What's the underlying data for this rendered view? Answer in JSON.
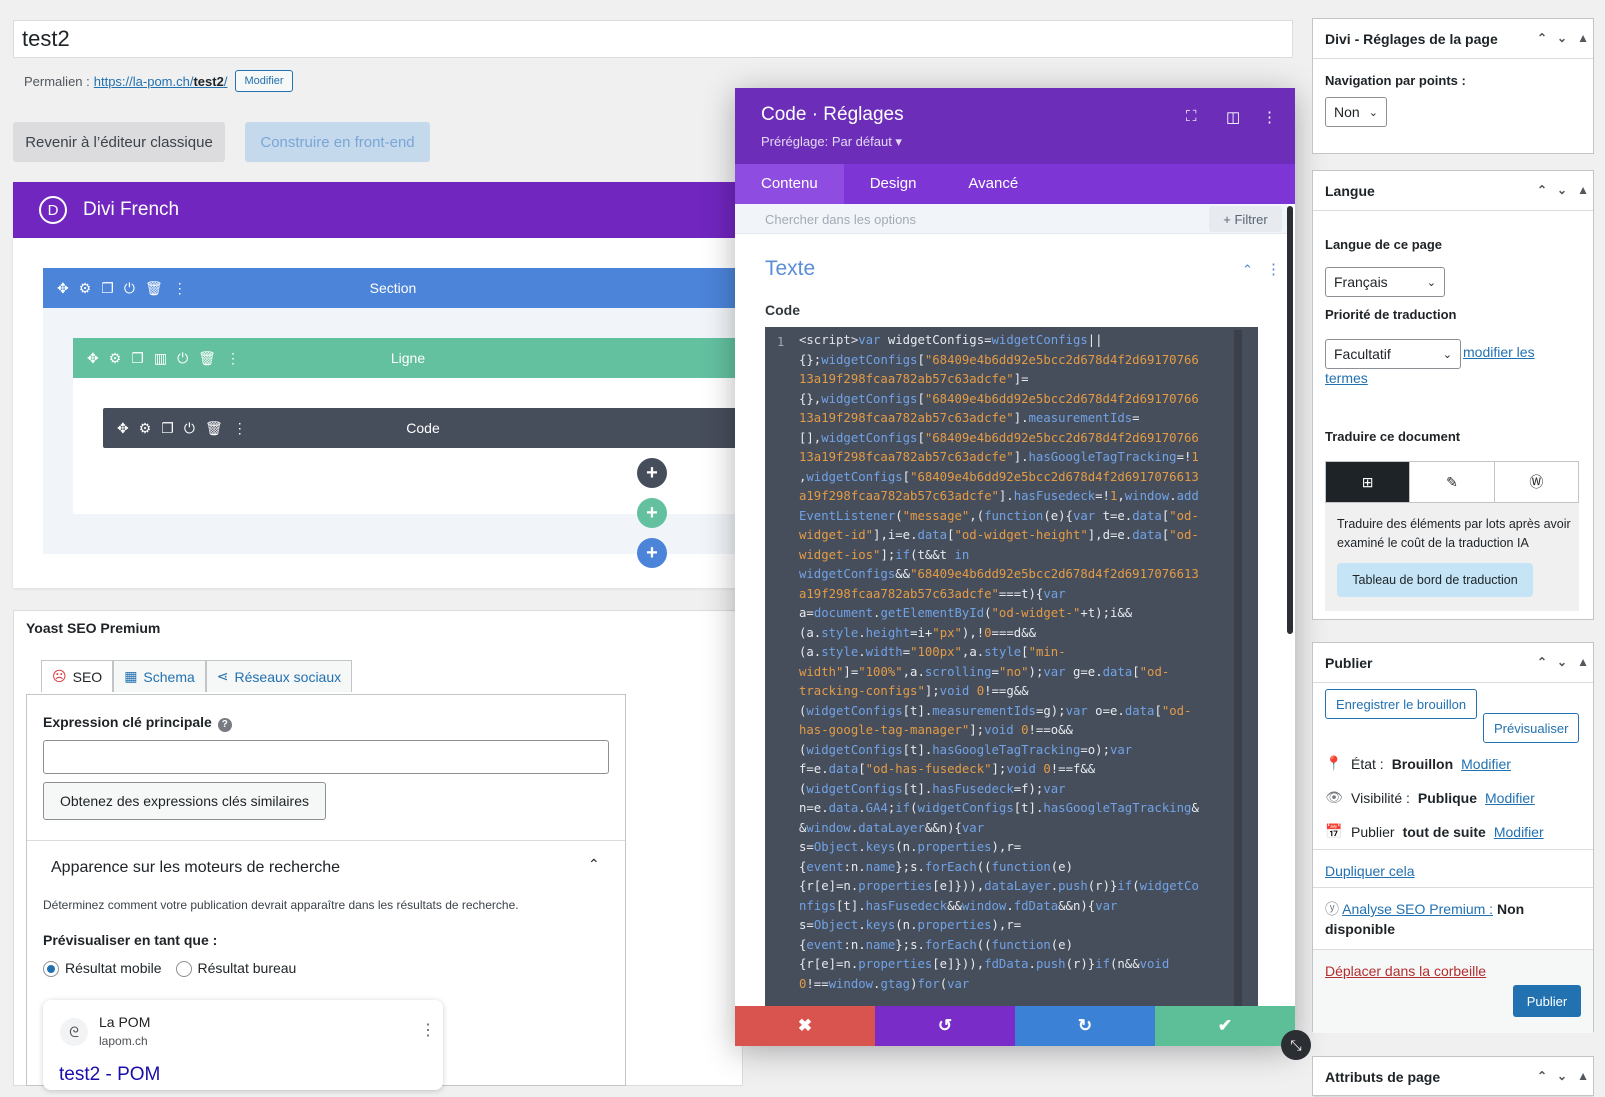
{
  "post": {
    "title": "test2",
    "permalink_label": "Permalien :",
    "permalink_url": "https://la-pom.ch/test2/",
    "permalink_base": "https://la-pom.ch/",
    "permalink_slug": "test2",
    "permalink_edit": "Modifier"
  },
  "editor_buttons": {
    "classic": "Revenir à l’éditeur classique",
    "frontend": "Construire en front-end"
  },
  "divi": {
    "logo_letter": "D",
    "title": "Divi French",
    "section_label": "Section",
    "row_label": "Ligne",
    "module_label": "Code",
    "colors": {
      "header": "#7026bf",
      "section": "#4c84d9",
      "row": "#63c1a0",
      "module": "#474e5b"
    }
  },
  "yoast": {
    "title": "Yoast SEO Premium",
    "tabs": [
      "SEO",
      "Schema",
      "Réseaux sociaux"
    ],
    "keyphrase_label": "Expression clé principale",
    "keyphrase_help": "?",
    "keyphrase_value": "",
    "related_button": "Obtenez des expressions clés similaires",
    "appearance_title": "Apparence sur les moteurs de recherche",
    "appearance_desc": "Déterminez comment votre publication devrait apparaître dans les résultats de recherche.",
    "preview_as": "Prévisualiser en tant que :",
    "radio_mobile": "Résultat mobile",
    "radio_desktop": "Résultat bureau",
    "snippet": {
      "site": "La POM",
      "url": "lapom.ch",
      "title": "test2 - POM"
    }
  },
  "modal": {
    "title": "Code · Réglages",
    "preset": "Préréglage: Par défaut ▾",
    "tabs": [
      "Contenu",
      "Design",
      "Avancé"
    ],
    "search_placeholder": "Chercher dans les options",
    "filter": "+ Filtrer",
    "section_title": "Texte",
    "code_label": "Code",
    "line_number": "1",
    "footer_icons": [
      "close-icon",
      "undo-icon",
      "redo-icon",
      "check-icon"
    ],
    "footer_colors": [
      "#d9534f",
      "#7a2cc8",
      "#3b82d6",
      "#5cbf98"
    ]
  },
  "sidebar": {
    "divi_settings": {
      "title": "Divi - Réglages de la page",
      "dots_label": "Navigation par points :",
      "dots_value": "Non"
    },
    "language": {
      "title": "Langue",
      "page_lang_label": "Langue de ce page",
      "page_lang_value": "Français",
      "priority_label": "Priorité de traduction",
      "priority_value": "Facultatif",
      "modify_terms": "modifier les termes",
      "translate_label": "Traduire ce document",
      "translate_desc": "Traduire des éléments par lots après avoir examiné le coût de la traduction IA",
      "dashboard_btn": "Tableau de bord de traduction"
    },
    "publish": {
      "title": "Publier",
      "save_draft": "Enregistrer le brouillon",
      "preview": "Prévisualiser",
      "state_label": "État :",
      "state_value": "Brouillon",
      "visibility_label": "Visibilité :",
      "visibility_value": "Publique",
      "publish_label": "Publier",
      "publish_value": "tout de suite",
      "modify": "Modifier",
      "duplicate": "Dupliquer cela",
      "seo_label": "Analyse SEO Premium :",
      "seo_value": "Non disponible",
      "trash": "Déplacer dans la corbeille",
      "publish_btn": "Publier"
    },
    "page_attributes": {
      "title": "Attributs de page"
    }
  }
}
